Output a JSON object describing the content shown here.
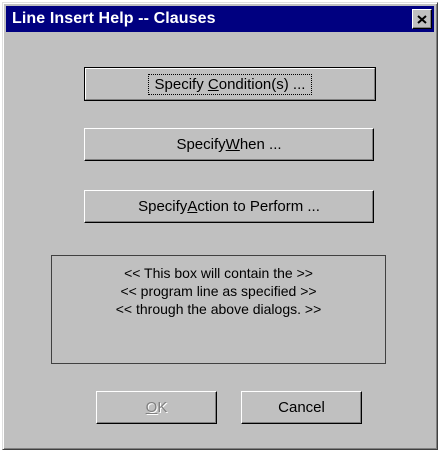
{
  "window": {
    "title": "Line Insert Help -- Clauses",
    "close_icon": "close-x-icon"
  },
  "buttons": {
    "condition": {
      "pre": "Specify ",
      "key": "C",
      "post": "ondition(s) ..."
    },
    "when": {
      "pre": "Specify ",
      "key": "W",
      "post": "hen ..."
    },
    "action": {
      "pre": "Specify ",
      "key": "A",
      "post": "ction to Perform ..."
    },
    "ok": {
      "pre": "",
      "key": "O",
      "post": "K"
    },
    "cancel": "Cancel"
  },
  "preview": {
    "lines": [
      "<< This box will contain the >>",
      "<< program line as specified >>",
      "<< through the above dialogs. >>"
    ]
  },
  "colors": {
    "titlebar": "#000080",
    "face": "#c0c0c0"
  }
}
